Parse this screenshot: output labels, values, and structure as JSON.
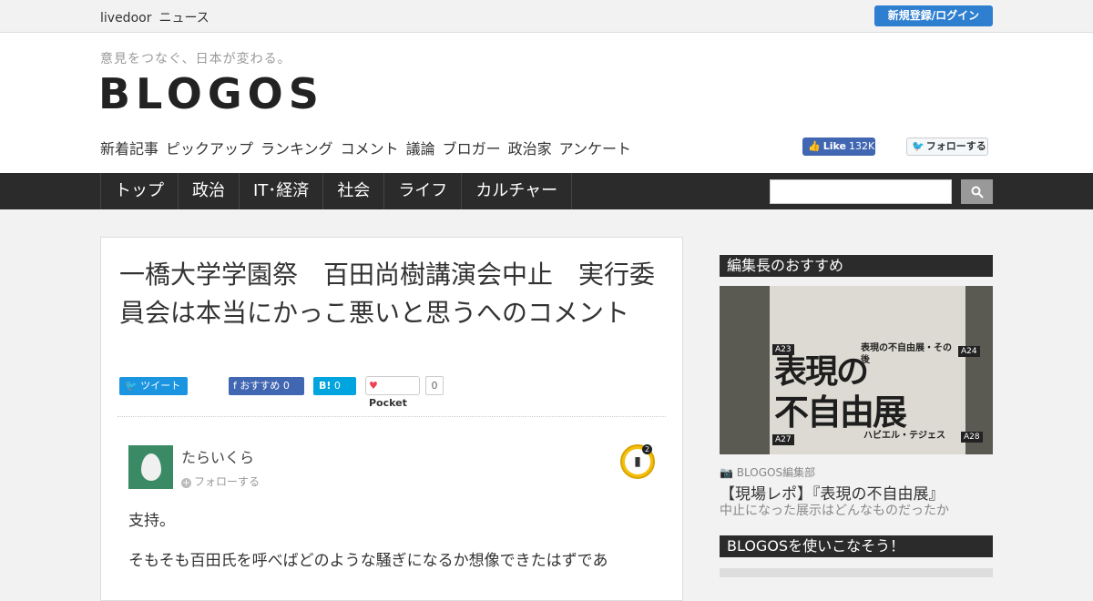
{
  "topbar": {
    "brand_1": "livedoor",
    "brand_2": "ニュース",
    "login": "新規登録/ログイン"
  },
  "header": {
    "tagline": "意見をつなぐ、日本が変わる。",
    "logo": "BLOGOS",
    "subnav": [
      "新着記事",
      "ピックアップ",
      "ランキング",
      "コメント",
      "議論",
      "ブロガー",
      "政治家",
      "アンケート"
    ],
    "fb_like": {
      "label": "Like",
      "count": "132K"
    },
    "tw_follow": "フォローする"
  },
  "mainnav": [
    "トップ",
    "政治",
    "IT･経済",
    "社会",
    "ライフ",
    "カルチャー"
  ],
  "search": {
    "placeholder": ""
  },
  "article": {
    "title": "一橋大学学園祭　百田尚樹講演会中止　実行委員会は本当にかっこ悪いと思うへのコメント",
    "share": {
      "tweet": "ツイート",
      "fb": "おすすめ",
      "fb_count": "0",
      "hatena": "B!",
      "hatena_count": "0",
      "pocket": "Pocket",
      "pocket_count": "0"
    },
    "author": "たらいくら",
    "follow": "フォローする",
    "badge_count": "2",
    "comment_line1": "支持。",
    "comment_line2": "そもそも百田氏を呼べばどのような騒ぎになるか想像できたはずであ"
  },
  "sidebar": {
    "head1": "編集長のおすすめ",
    "image": {
      "big1": "表現の",
      "big2": "不自由展",
      "tags": [
        "A23",
        "A24",
        "A27",
        "A28"
      ],
      "title1": "表現の不自由展・その後",
      "title2": "ハビエル・テジェス"
    },
    "source": "BLOGOS編集部",
    "title": "【現場レポ】『表現の不自由展』",
    "desc": "中止になった展示はどんなものだったか",
    "head2": "BLOGOSを使いこなそう！"
  }
}
